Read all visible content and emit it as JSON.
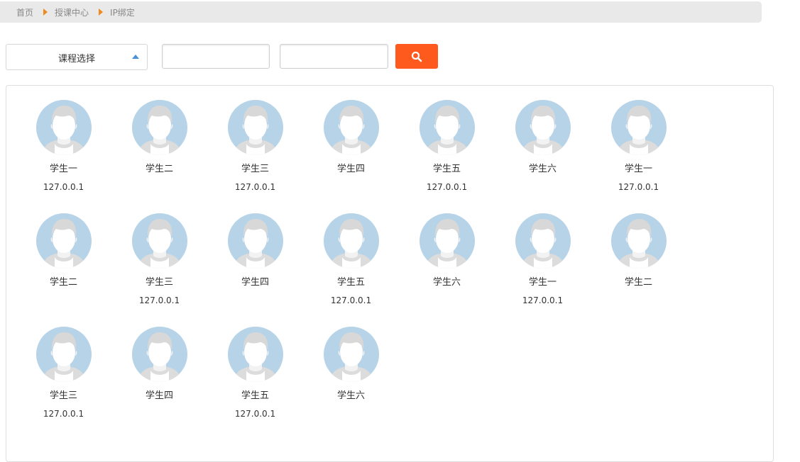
{
  "breadcrumb": {
    "items": [
      "首页",
      "授课中心",
      "IP绑定"
    ]
  },
  "toolbar": {
    "course_select_label": "课程选择",
    "input1_value": "",
    "input2_value": "",
    "search_icon": "search-icon"
  },
  "colors": {
    "accent": "#fe5a1e",
    "crumb_arrow": "#f08a1e",
    "caret": "#4a90d9",
    "avatar_bg": "#b7d3e8"
  },
  "students": [
    {
      "name": "学生一",
      "ip": "127.0.0.1"
    },
    {
      "name": "学生二",
      "ip": ""
    },
    {
      "name": "学生三",
      "ip": "127.0.0.1"
    },
    {
      "name": "学生四",
      "ip": ""
    },
    {
      "name": "学生五",
      "ip": "127.0.0.1"
    },
    {
      "name": "学生六",
      "ip": ""
    },
    {
      "name": "学生一",
      "ip": "127.0.0.1"
    },
    {
      "name": "学生二",
      "ip": ""
    },
    {
      "name": "学生三",
      "ip": "127.0.0.1"
    },
    {
      "name": "学生四",
      "ip": ""
    },
    {
      "name": "学生五",
      "ip": "127.0.0.1"
    },
    {
      "name": "学生六",
      "ip": ""
    },
    {
      "name": "学生一",
      "ip": "127.0.0.1"
    },
    {
      "name": "学生二",
      "ip": ""
    },
    {
      "name": "学生三",
      "ip": "127.0.0.1"
    },
    {
      "name": "学生四",
      "ip": ""
    },
    {
      "name": "学生五",
      "ip": "127.0.0.1"
    },
    {
      "name": "学生六",
      "ip": ""
    }
  ]
}
